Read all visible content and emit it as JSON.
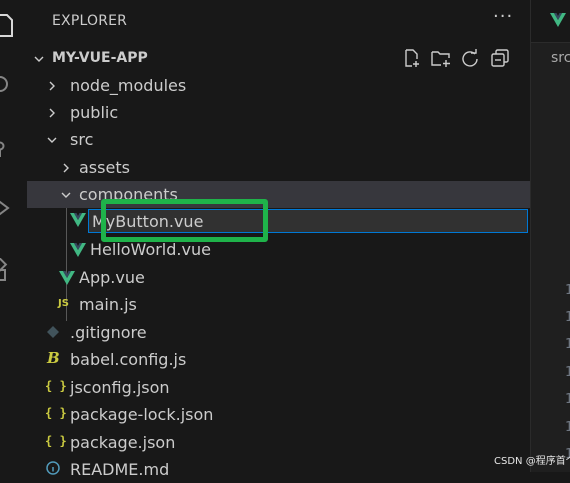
{
  "explorer": {
    "header": "EXPLORER",
    "more": "···",
    "root_label": "MY-VUE-APP",
    "actions": [
      "new-file",
      "new-folder",
      "refresh",
      "collapse-all"
    ]
  },
  "tree": [
    {
      "label": "node_modules",
      "kind": "folder",
      "expanded": false,
      "depth": 0
    },
    {
      "label": "public",
      "kind": "folder",
      "expanded": false,
      "depth": 0
    },
    {
      "label": "src",
      "kind": "folder",
      "expanded": true,
      "depth": 0
    },
    {
      "label": "assets",
      "kind": "folder",
      "expanded": false,
      "depth": 1
    },
    {
      "label": "components",
      "kind": "folder",
      "expanded": true,
      "depth": 1,
      "selected": true
    },
    {
      "label": "HelloWorld.vue",
      "kind": "vue",
      "depth": 2
    },
    {
      "label": "App.vue",
      "kind": "vue",
      "depth": 1
    },
    {
      "label": "main.js",
      "kind": "js",
      "depth": 1
    },
    {
      "label": ".gitignore",
      "kind": "git",
      "depth": 0
    },
    {
      "label": "babel.config.js",
      "kind": "babel",
      "depth": 0
    },
    {
      "label": "jsconfig.json",
      "kind": "json",
      "depth": 0
    },
    {
      "label": "package-lock.json",
      "kind": "json",
      "depth": 0
    },
    {
      "label": "package.json",
      "kind": "json",
      "depth": 0
    },
    {
      "label": "README.md",
      "kind": "info",
      "depth": 0
    }
  ],
  "rename": {
    "value": "MyButton.vue",
    "icon": "vue-icon"
  },
  "editor": {
    "breadcrumb": "src",
    "line_numbers": [
      "1",
      "1",
      "1",
      "1",
      "1",
      "1",
      "1"
    ]
  },
  "icons": {
    "js_badge": "JS",
    "json_badge": "{ }",
    "babel_badge": "B"
  },
  "colors": {
    "vue_green": "#41b883",
    "js_yellow": "#cbcb41",
    "json_yellow": "#cbcb41",
    "highlight_green": "#1fb34a",
    "focus_blue": "#0078d4"
  },
  "watermark": "CSDN @程序首个"
}
